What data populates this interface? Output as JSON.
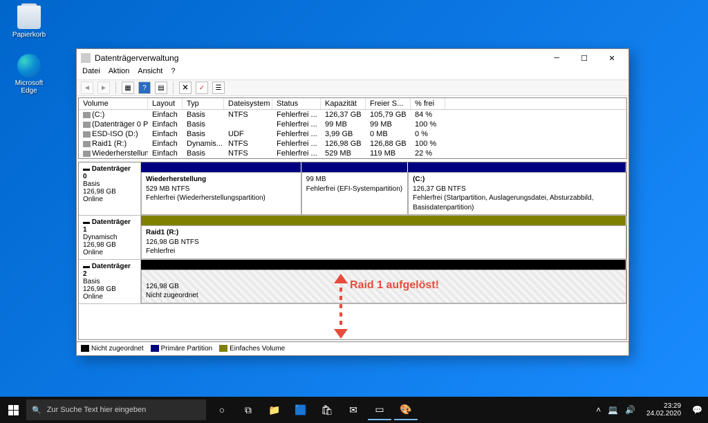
{
  "desktop": {
    "recycle": "Papierkorb",
    "edge": "Microsoft Edge"
  },
  "window": {
    "title": "Datenträgerverwaltung",
    "menu": [
      "Datei",
      "Aktion",
      "Ansicht",
      "?"
    ]
  },
  "columns": {
    "vol": "Volume",
    "lay": "Layout",
    "typ": "Typ",
    "fs": "Dateisystem",
    "stat": "Status",
    "cap": "Kapazität",
    "free": "Freier S...",
    "pct": "% frei"
  },
  "volumes": [
    {
      "vol": "(C:)",
      "lay": "Einfach",
      "typ": "Basis",
      "fs": "NTFS",
      "stat": "Fehlerfrei ...",
      "cap": "126,37 GB",
      "free": "105,79 GB",
      "pct": "84 %"
    },
    {
      "vol": "(Datenträger 0 Par...",
      "lay": "Einfach",
      "typ": "Basis",
      "fs": "",
      "stat": "Fehlerfrei ...",
      "cap": "99 MB",
      "free": "99 MB",
      "pct": "100 %"
    },
    {
      "vol": "ESD-ISO (D:)",
      "lay": "Einfach",
      "typ": "Basis",
      "fs": "UDF",
      "stat": "Fehlerfrei ...",
      "cap": "3,99 GB",
      "free": "0 MB",
      "pct": "0 %"
    },
    {
      "vol": "Raid1 (R:)",
      "lay": "Einfach",
      "typ": "Dynamis...",
      "fs": "NTFS",
      "stat": "Fehlerfrei ...",
      "cap": "126,98 GB",
      "free": "126,88 GB",
      "pct": "100 %"
    },
    {
      "vol": "Wiederherstellung",
      "lay": "Einfach",
      "typ": "Basis",
      "fs": "NTFS",
      "stat": "Fehlerfrei ...",
      "cap": "529 MB",
      "free": "119 MB",
      "pct": "22 %"
    }
  ],
  "disks": {
    "d0": {
      "name": "Datenträger 0",
      "type": "Basis",
      "size": "126,98 GB",
      "state": "Online",
      "p1": {
        "name": "Wiederherstellung",
        "l2": "529 MB NTFS",
        "l3": "Fehlerfrei (Wiederherstellungspartition)"
      },
      "p2": {
        "l2": "99 MB",
        "l3": "Fehlerfrei (EFI-Systempartition)"
      },
      "p3": {
        "name": "(C:)",
        "l2": "126,37 GB NTFS",
        "l3": "Fehlerfrei (Startpartition, Auslagerungsdatei, Absturzabbild, Basisdatenpartition)"
      }
    },
    "d1": {
      "name": "Datenträger 1",
      "type": "Dynamisch",
      "size": "126,98 GB",
      "state": "Online",
      "p1": {
        "name": "Raid1  (R:)",
        "l2": "126,98 GB NTFS",
        "l3": "Fehlerfrei"
      }
    },
    "d2": {
      "name": "Datenträger 2",
      "type": "Basis",
      "size": "126,98 GB",
      "state": "Online",
      "p1": {
        "l2": "126,98 GB",
        "l3": "Nicht zugeordnet"
      }
    }
  },
  "legend": {
    "un": "Nicht zugeordnet",
    "pri": "Primäre Partition",
    "simple": "Einfaches Volume"
  },
  "annotation": "Raid 1 aufgelöst!",
  "taskbar": {
    "search_placeholder": "Zur Suche Text hier eingeben",
    "time": "23:29",
    "date": "24.02.2020"
  }
}
